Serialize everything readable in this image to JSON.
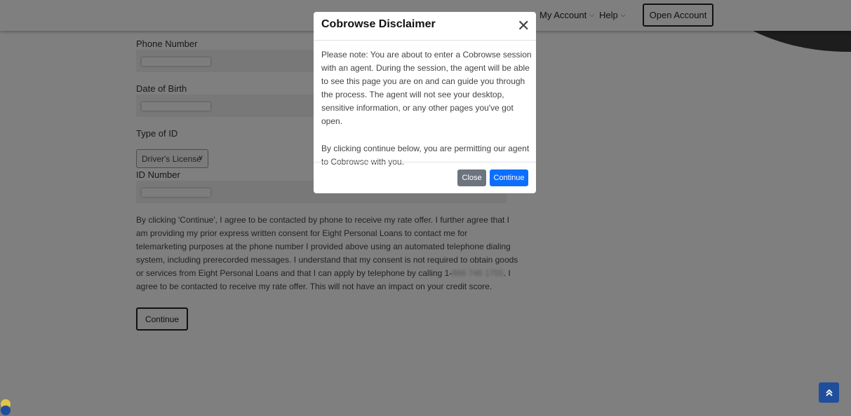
{
  "header": {
    "nav": [
      {
        "label": "My Account",
        "icon": "chevron-down-icon"
      },
      {
        "label": "Help",
        "icon": "chevron-down-icon"
      }
    ],
    "open_account_label": "Open Account"
  },
  "form": {
    "phone_label": "Phone Number",
    "dob_label": "Date of Birth",
    "id_type_label": "Type of ID",
    "id_type_selected": "Driver's License",
    "id_number_label": "ID Number",
    "consent_before": "By clicking 'Continue', I agree to be contacted by phone to receive my rate offer. I further agree that I am providing my prior express written consent for Eight Personal Loans to contact me for telemarketing purposes at the phone number I provided above using an automated telephone dialing system, including prerecorded messages. I understand that my consent is not required to obtain goods or services from Eight Personal Loans and that I can apply by telephone by calling 1-",
    "consent_phone_masked": "866 746 1755",
    "consent_after": ". I agree to be contacted to receive my rate offer. This will not have an impact on your credit score.",
    "continue_label": "Continue"
  },
  "modal": {
    "title": "Cobrowse Disclaimer",
    "close_icon": "close-icon",
    "body_p1": "Please note: You are about to enter a Cobrowse session with an agent. During the session, the agent will be able to see this page you are on and can guide you through the process. The agent will not see your desktop, sensitive information, or any other pages you've got open.",
    "body_p2": "By clicking continue below, you are permitting our agent to Cobrowse with you.",
    "close_label": "Close",
    "continue_label": "Continue"
  },
  "floating": {
    "scroll_top_icon": "double-chevron-up-icon"
  },
  "colors": {
    "primary_blue": "#0d6efd",
    "secondary_gray": "#6c757d",
    "scroll_top_bg": "#1f4f9c",
    "overlay": "rgba(0,0,0,0.5)"
  }
}
